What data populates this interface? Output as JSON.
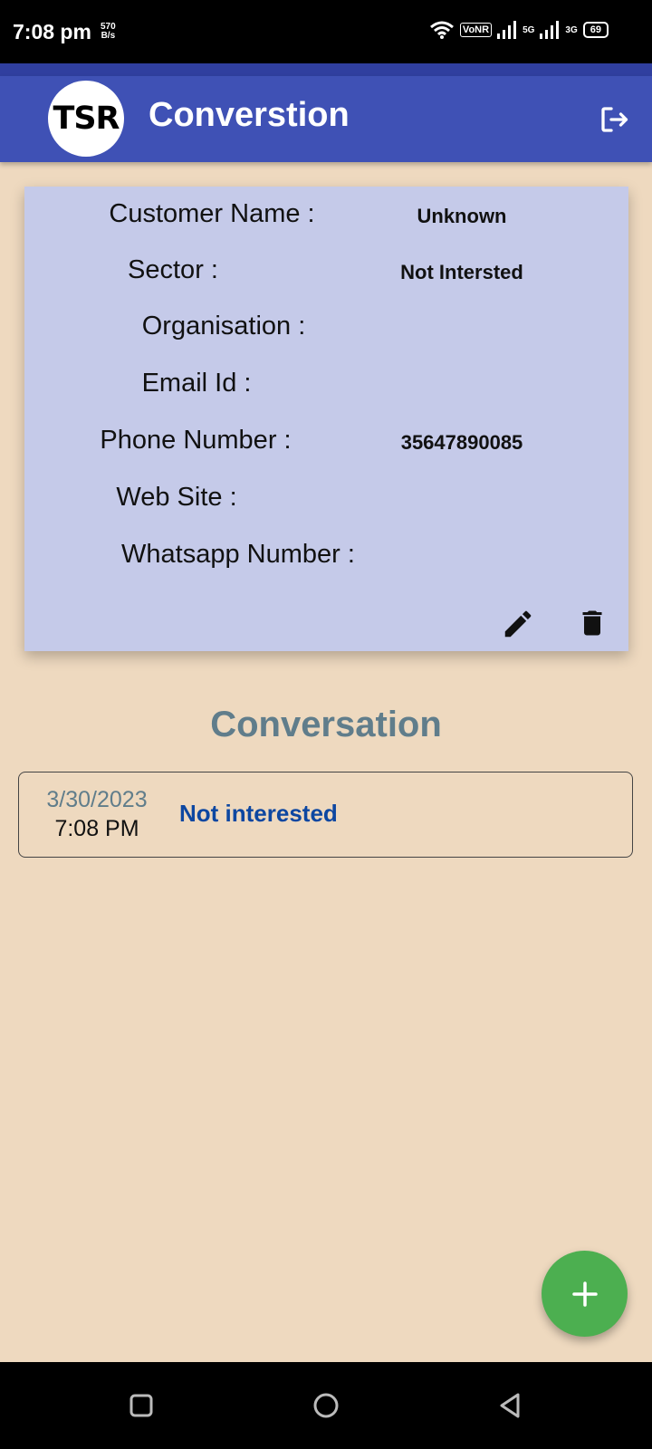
{
  "status_bar": {
    "time": "7:08 pm",
    "speed_value": "570",
    "speed_unit": "B/s",
    "vonr": "VoNR",
    "net1": "5G",
    "net2": "3G",
    "battery": "69"
  },
  "appbar": {
    "logo_text": "TSR",
    "title": "Converstion",
    "logout_icon": "logout-icon"
  },
  "customer": {
    "name_label": "Customer Name :",
    "name_value": "Unknown",
    "sector_label": "Sector :",
    "sector_value": "Not Intersted",
    "organisation_label": "Organisation :",
    "organisation_value": "",
    "email_label": "Email Id :",
    "email_value": "",
    "phone_label": "Phone Number :",
    "phone_value": "35647890085",
    "website_label": "Web Site :",
    "website_value": "",
    "whatsapp_label": "Whatsapp Number :",
    "whatsapp_value": ""
  },
  "conversation": {
    "title": "Conversation",
    "items": [
      {
        "date": "3/30/2023",
        "time": "7:08 PM",
        "text": "Not interested"
      }
    ]
  },
  "colors": {
    "background": "#eed9bf",
    "appbar": "#3f51b5",
    "card": "#c5cae9",
    "fab": "#4caf50",
    "conversation_title": "#607d8b",
    "conversation_text": "#0d47a1"
  }
}
